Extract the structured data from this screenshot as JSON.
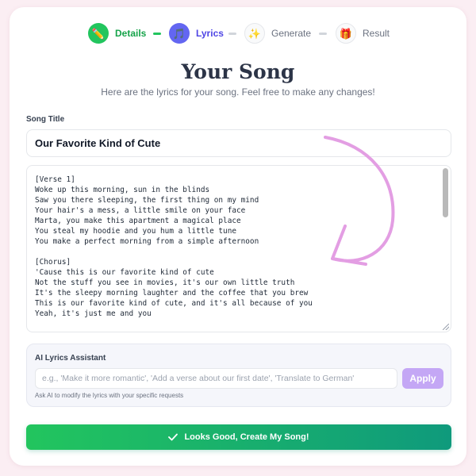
{
  "stepper": {
    "steps": [
      {
        "label": "Details",
        "icon": "pencil-icon",
        "glyph": "✏️",
        "state": "done"
      },
      {
        "label": "Lyrics",
        "icon": "music-note-icon",
        "glyph": "🎵",
        "state": "active"
      },
      {
        "label": "Generate",
        "icon": "sparkles-icon",
        "glyph": "✨",
        "state": "todo"
      },
      {
        "label": "Result",
        "icon": "gift-icon",
        "glyph": "🎁",
        "state": "todo"
      }
    ]
  },
  "header": {
    "title": "Your Song",
    "subtitle": "Here are the lyrics for your song. Feel free to make any changes!"
  },
  "song_title": {
    "label": "Song Title",
    "value": "Our Favorite Kind of Cute"
  },
  "lyrics": {
    "text": "[Verse 1]\nWoke up this morning, sun in the blinds\nSaw you there sleeping, the first thing on my mind\nYour hair's a mess, a little smile on your face\nMarta, you make this apartment a magical place\nYou steal my hoodie and you hum a little tune\nYou make a perfect morning from a simple afternoon\n\n[Chorus]\n'Cause this is our favorite kind of cute\nNot the stuff you see in movies, it's our own little truth\nIt's the sleepy morning laughter and the coffee that you brew\nThis is our favorite kind of cute, and it's all because of you\nYeah, it's just me and you"
  },
  "assistant": {
    "label": "AI Lyrics Assistant",
    "placeholder": "e.g., 'Make it more romantic', 'Add a verse about our first date', 'Translate to German'",
    "apply_label": "Apply",
    "hint": "Ask AI to modify the lyrics with your specific requests"
  },
  "submit": {
    "label": "Looks Good, Create My Song!",
    "icon": "check-icon"
  },
  "colors": {
    "done": "#22c55e",
    "active": "#6366f1",
    "todo": "#d1d5db",
    "arrow": "#e39ee3",
    "apply": "#c4a7f5"
  }
}
